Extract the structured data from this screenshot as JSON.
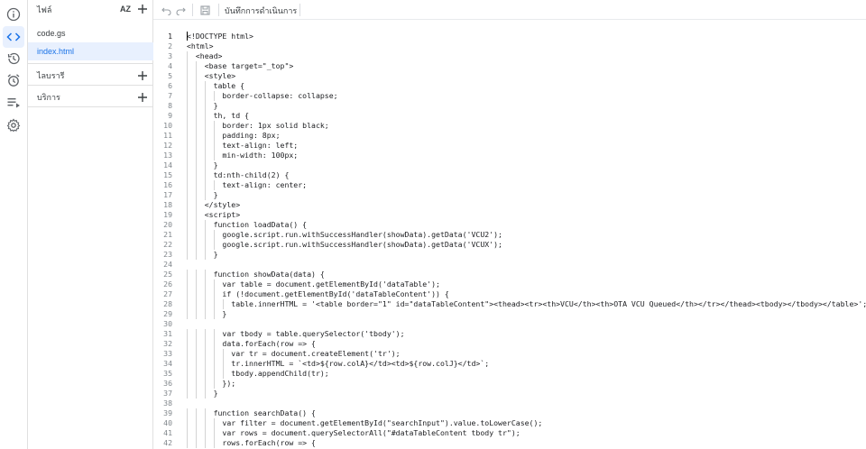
{
  "rail": {
    "items": [
      {
        "name": "overview-info-icon"
      },
      {
        "name": "editor-code-icon"
      },
      {
        "name": "history-icon"
      },
      {
        "name": "triggers-alarm-icon"
      },
      {
        "name": "executions-list-icon"
      },
      {
        "name": "settings-gear-icon"
      }
    ]
  },
  "files": {
    "title": "ไฟล์",
    "sort_label": "AZ",
    "items": [
      {
        "label": "code.gs"
      },
      {
        "label": "index.html"
      }
    ],
    "libraries_label": "ไลบรารี",
    "services_label": "บริการ"
  },
  "toolbar": {
    "execution_log_label": "บันทึกการดำเนินการ"
  },
  "editor": {
    "current_line": 1,
    "lines": [
      "<!DOCTYPE html>",
      "<html>",
      "  <head>",
      "    <base target=\"_top\">",
      "    <style>",
      "      table {",
      "        border-collapse: collapse;",
      "      }",
      "      th, td {",
      "        border: 1px solid black;",
      "        padding: 8px;",
      "        text-align: left;",
      "        min-width: 100px;",
      "      }",
      "      td:nth-child(2) {",
      "        text-align: center;",
      "      }",
      "    </style>",
      "    <script>",
      "      function loadData() {",
      "        google.script.run.withSuccessHandler(showData).getData('VCU2');",
      "        google.script.run.withSuccessHandler(showData).getData('VCUX');",
      "      }",
      "",
      "      function showData(data) {",
      "        var table = document.getElementById('dataTable');",
      "        if (!document.getElementById('dataTableContent')) {",
      "          table.innerHTML = '<table border=\"1\" id=\"dataTableContent\"><thead><tr><th>VCU</th><th>OTA VCU Queued</th></tr></thead><tbody></tbody></table>';",
      "        }",
      "",
      "        var tbody = table.querySelector('tbody');",
      "        data.forEach(row => {",
      "          var tr = document.createElement('tr');",
      "          tr.innerHTML = `<td>${row.colA}</td><td>${row.colJ}</td>`;",
      "          tbody.appendChild(tr);",
      "        });",
      "      }",
      "",
      "      function searchData() {",
      "        var filter = document.getElementById(\"searchInput\").value.toLowerCase();",
      "        var rows = document.querySelectorAll(\"#dataTableContent tbody tr\");",
      "        rows.forEach(row => {"
    ]
  }
}
